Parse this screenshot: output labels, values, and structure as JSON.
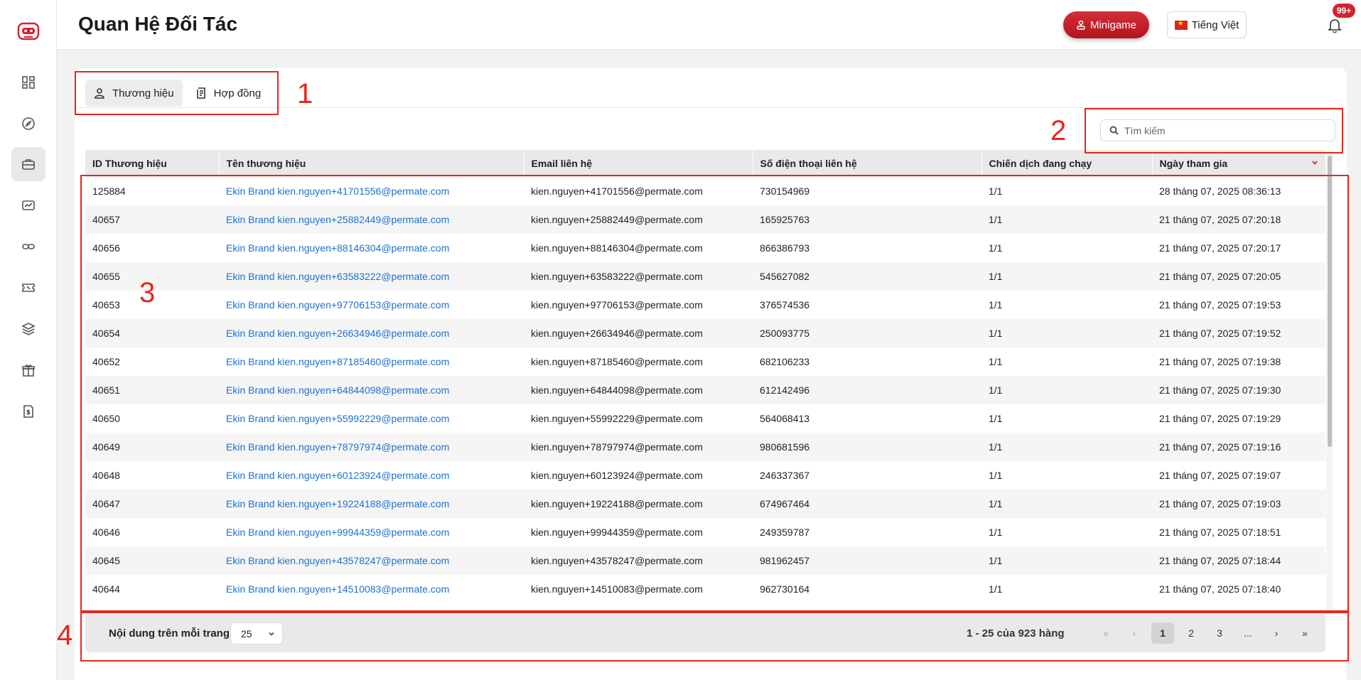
{
  "header": {
    "title": "Quan Hệ Đối Tác",
    "minigame_label": "Minigame",
    "language_label": "Tiếng Việt",
    "notification_count": "99+"
  },
  "sidebar": {
    "items": [
      {
        "icon": "dashboard-icon"
      },
      {
        "icon": "compass-icon"
      },
      {
        "icon": "briefcase-icon",
        "active": true
      },
      {
        "icon": "ticket-chart-icon"
      },
      {
        "icon": "link-icon"
      },
      {
        "icon": "voucher-icon"
      },
      {
        "icon": "layers-icon"
      },
      {
        "icon": "gift-icon"
      },
      {
        "icon": "document-dollar-icon"
      }
    ]
  },
  "tabs": [
    {
      "label": "Thương hiệu",
      "active": true
    },
    {
      "label": "Hợp đồng",
      "active": false
    }
  ],
  "search": {
    "placeholder": "Tìm kiếm"
  },
  "table": {
    "columns": [
      "ID Thương hiệu",
      "Tên thương hiệu",
      "Email liên hệ",
      "Số điện thoại liên hệ",
      "Chiến dịch đang chạy",
      "Ngày tham gia"
    ],
    "rows": [
      [
        "125884",
        "Ekin Brand kien.nguyen+41701556@permate.com",
        "kien.nguyen+41701556@permate.com",
        "730154969",
        "1/1",
        "28 tháng 07, 2025 08:36:13"
      ],
      [
        "40657",
        "Ekin Brand kien.nguyen+25882449@permate.com",
        "kien.nguyen+25882449@permate.com",
        "165925763",
        "1/1",
        "21 tháng 07, 2025 07:20:18"
      ],
      [
        "40656",
        "Ekin Brand kien.nguyen+88146304@permate.com",
        "kien.nguyen+88146304@permate.com",
        "866386793",
        "1/1",
        "21 tháng 07, 2025 07:20:17"
      ],
      [
        "40655",
        "Ekin Brand kien.nguyen+63583222@permate.com",
        "kien.nguyen+63583222@permate.com",
        "545627082",
        "1/1",
        "21 tháng 07, 2025 07:20:05"
      ],
      [
        "40653",
        "Ekin Brand kien.nguyen+97706153@permate.com",
        "kien.nguyen+97706153@permate.com",
        "376574536",
        "1/1",
        "21 tháng 07, 2025 07:19:53"
      ],
      [
        "40654",
        "Ekin Brand kien.nguyen+26634946@permate.com",
        "kien.nguyen+26634946@permate.com",
        "250093775",
        "1/1",
        "21 tháng 07, 2025 07:19:52"
      ],
      [
        "40652",
        "Ekin Brand kien.nguyen+87185460@permate.com",
        "kien.nguyen+87185460@permate.com",
        "682106233",
        "1/1",
        "21 tháng 07, 2025 07:19:38"
      ],
      [
        "40651",
        "Ekin Brand kien.nguyen+64844098@permate.com",
        "kien.nguyen+64844098@permate.com",
        "612142496",
        "1/1",
        "21 tháng 07, 2025 07:19:30"
      ],
      [
        "40650",
        "Ekin Brand kien.nguyen+55992229@permate.com",
        "kien.nguyen+55992229@permate.com",
        "564068413",
        "1/1",
        "21 tháng 07, 2025 07:19:29"
      ],
      [
        "40649",
        "Ekin Brand kien.nguyen+78797974@permate.com",
        "kien.nguyen+78797974@permate.com",
        "980681596",
        "1/1",
        "21 tháng 07, 2025 07:19:16"
      ],
      [
        "40648",
        "Ekin Brand kien.nguyen+60123924@permate.com",
        "kien.nguyen+60123924@permate.com",
        "246337367",
        "1/1",
        "21 tháng 07, 2025 07:19:07"
      ],
      [
        "40647",
        "Ekin Brand kien.nguyen+19224188@permate.com",
        "kien.nguyen+19224188@permate.com",
        "674967464",
        "1/1",
        "21 tháng 07, 2025 07:19:03"
      ],
      [
        "40646",
        "Ekin Brand kien.nguyen+99944359@permate.com",
        "kien.nguyen+99944359@permate.com",
        "249359787",
        "1/1",
        "21 tháng 07, 2025 07:18:51"
      ],
      [
        "40645",
        "Ekin Brand kien.nguyen+43578247@permate.com",
        "kien.nguyen+43578247@permate.com",
        "981962457",
        "1/1",
        "21 tháng 07, 2025 07:18:44"
      ],
      [
        "40644",
        "Ekin Brand kien.nguyen+14510083@permate.com",
        "kien.nguyen+14510083@permate.com",
        "962730164",
        "1/1",
        "21 tháng 07, 2025 07:18:40"
      ]
    ]
  },
  "pagination": {
    "per_page_label": "Nội dung trên mỗi trang:",
    "per_page_value": "25",
    "range_text": "1 - 25 của 923 hàng",
    "pages": [
      "1",
      "2",
      "3",
      "..."
    ],
    "current_page": "1",
    "first": "«",
    "prev": "‹",
    "next": "›",
    "last": "»"
  },
  "annotations": [
    "1",
    "2",
    "3",
    "4"
  ],
  "colors": {
    "accent": "#d6222f",
    "link": "#1f6fd1",
    "annotation": "#e8261b"
  }
}
